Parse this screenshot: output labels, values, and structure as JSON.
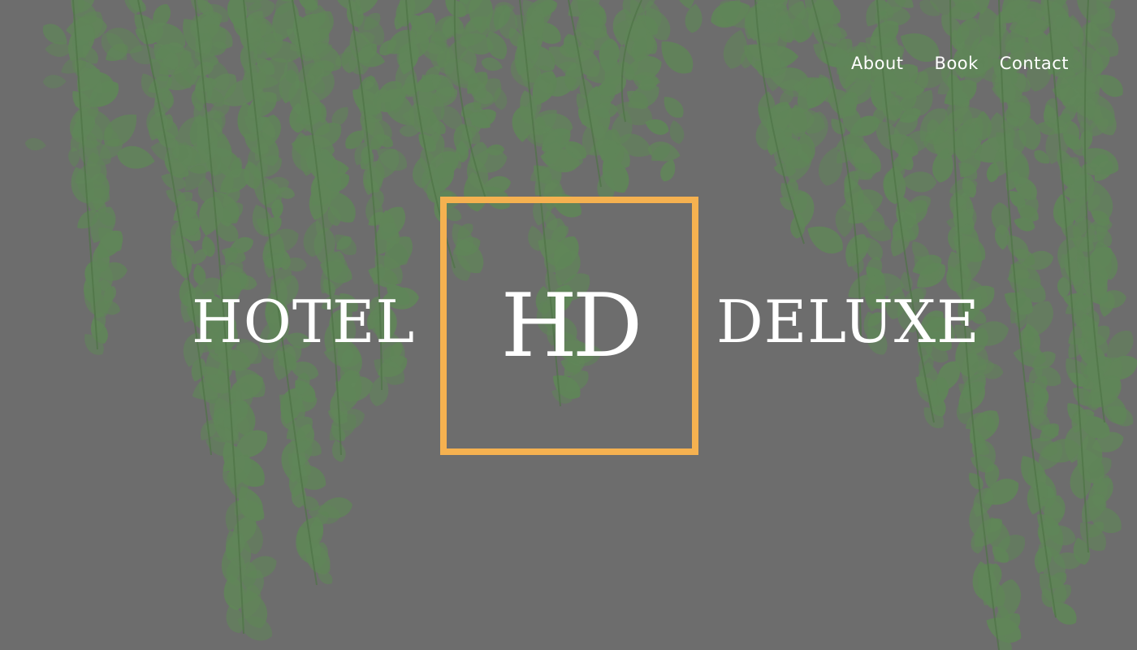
{
  "nav": {
    "about": "About",
    "book": "Book",
    "contact": "Contact"
  },
  "brand": {
    "left": "HOTEL",
    "mark": "HD",
    "right": "DELUXE"
  },
  "colors": {
    "background": "#6d6d6d",
    "accent": "#f5b150",
    "text": "#ffffff",
    "leaf": "#5e8a55"
  }
}
